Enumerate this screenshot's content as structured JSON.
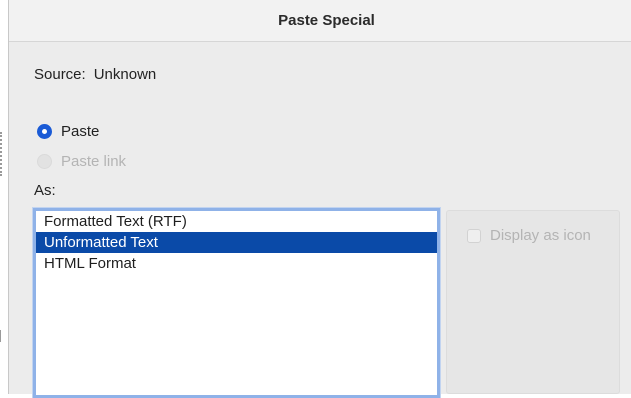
{
  "dialog": {
    "title": "Paste Special",
    "source_label": "Source:",
    "source_value": "Unknown",
    "paste_options": [
      {
        "label": "Paste",
        "checked": true,
        "disabled": false
      },
      {
        "label": "Paste link",
        "checked": false,
        "disabled": true
      }
    ],
    "as_label": "As:",
    "formats": [
      {
        "label": "Formatted Text (RTF)",
        "selected": false
      },
      {
        "label": "Unformatted Text",
        "selected": true
      },
      {
        "label": "HTML Format",
        "selected": false
      }
    ],
    "display_as_icon": {
      "label": "Display as icon",
      "checked": false,
      "disabled": true
    }
  },
  "colors": {
    "accent": "#1a5bd6",
    "selection": "#0a4aa8",
    "list_focus_ring": "#8fb2e8",
    "window_bg": "#ececec"
  }
}
